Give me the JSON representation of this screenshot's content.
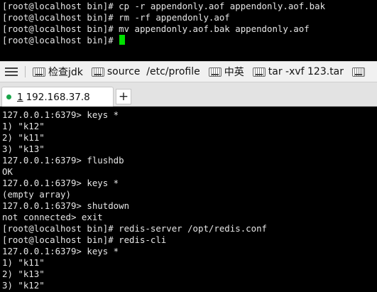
{
  "top_terminal": {
    "lines": [
      "[root@localhost bin]# cp -r appendonly.aof appendonly.aof.bak",
      "[root@localhost bin]# rm -rf appendonly.aof",
      "[root@localhost bin]# mv appendonly.aof.bak appendonly.aof",
      "[root@localhost bin]# "
    ],
    "cursor_color": "#00e000"
  },
  "quick_bar": {
    "menu_icon": "hamburger-menu-icon",
    "items": [
      {
        "label": "检查jdk",
        "icon": "keyboard-icon"
      },
      {
        "label": "source  /etc/profile",
        "icon": "keyboard-icon"
      },
      {
        "label": "中英",
        "icon": "keyboard-icon"
      },
      {
        "label": "tar -xvf 123.tar",
        "icon": "keyboard-icon"
      }
    ]
  },
  "tabs": {
    "items": [
      {
        "number": "1",
        "label": "192.168.37.8",
        "status_color": "#1aa54a"
      }
    ],
    "add_label": "+"
  },
  "main_terminal": {
    "lines": [
      "127.0.0.1:6379> keys *",
      "1) \"k12\"",
      "2) \"k11\"",
      "3) \"k13\"",
      "127.0.0.1:6379> flushdb",
      "OK",
      "127.0.0.1:6379> keys *",
      "(empty array)",
      "127.0.0.1:6379> shutdown",
      "not connected> exit",
      "[root@localhost bin]# redis-server /opt/redis.conf",
      "[root@localhost bin]# redis-cli",
      "127.0.0.1:6379> keys *",
      "1) \"k11\"",
      "2) \"k13\"",
      "3) \"k12\""
    ]
  }
}
